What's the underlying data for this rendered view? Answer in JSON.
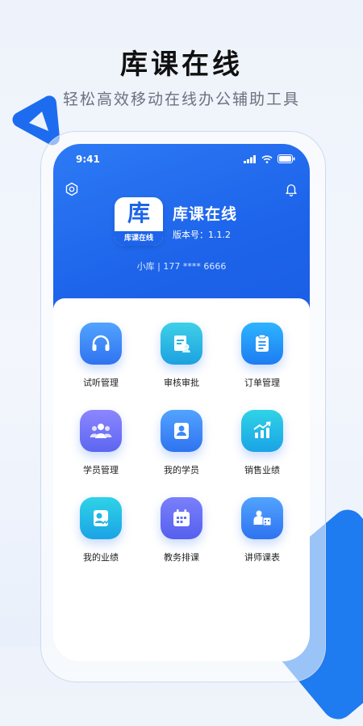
{
  "promo": {
    "headline": "库课在线",
    "subline": "轻松高效移动在线办公辅助工具"
  },
  "status_bar": {
    "time": "9:41"
  },
  "app": {
    "logo_big": "库",
    "logo_strip": "库课在线",
    "name": "库课在线",
    "version": "版本号：1.1.2",
    "user_line": "小库 | 177 **** 6666"
  },
  "menu": [
    {
      "label": "试听管理",
      "icon": "headphones-icon",
      "color": "#3d88f6"
    },
    {
      "label": "审核审批",
      "icon": "review-document-icon",
      "color": "#24b6e6"
    },
    {
      "label": "订单管理",
      "icon": "clipboard-icon",
      "color": "#2090f6"
    },
    {
      "label": "学员管理",
      "icon": "users-group-icon",
      "color": "#6f72f5"
    },
    {
      "label": "我的学员",
      "icon": "student-icon",
      "color": "#3d88f6"
    },
    {
      "label": "销售业绩",
      "icon": "growth-chart-icon",
      "color": "#24b6e6"
    },
    {
      "label": "我的业绩",
      "icon": "my-performance-icon",
      "color": "#24b6e6"
    },
    {
      "label": "教务排课",
      "icon": "calendar-icon",
      "color": "#6270f2"
    },
    {
      "label": "讲师课表",
      "icon": "teacher-schedule-icon",
      "color": "#3d88f6"
    }
  ]
}
